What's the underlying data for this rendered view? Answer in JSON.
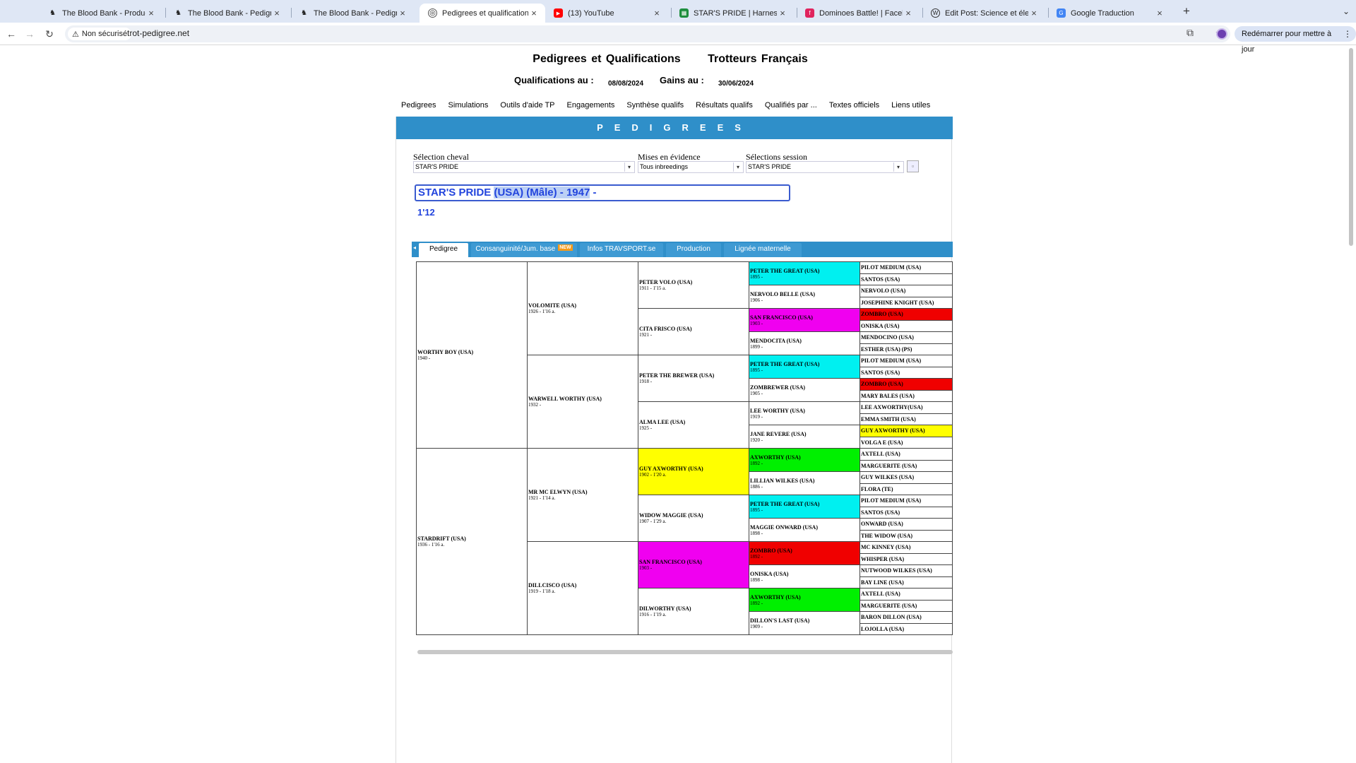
{
  "browser": {
    "tabs": [
      {
        "label": "The Blood Bank - Production",
        "icon": "horse-favicon",
        "active": false
      },
      {
        "label": "The Blood Bank - Pedigree",
        "icon": "horse-favicon",
        "active": false
      },
      {
        "label": "The Blood Bank - Pedigree",
        "icon": "horse-favicon",
        "active": false
      },
      {
        "label": "Pedigrees et qualifications Tr",
        "icon": "globe-icon",
        "active": true
      },
      {
        "label": "(13) YouTube",
        "icon": "youtube-icon",
        "active": false
      },
      {
        "label": "STAR'S PRIDE | Harness Musi",
        "icon": "sheets-icon",
        "active": false
      },
      {
        "label": "Dominoes Battle! | Facebook",
        "icon": "facebook-icon",
        "active": false
      },
      {
        "label": "Edit Post: Science et élevage",
        "icon": "wordpress-icon",
        "active": false
      },
      {
        "label": "Google Traduction",
        "icon": "translate-icon",
        "active": false
      }
    ],
    "security_label": "Non sécurisé",
    "url": "trot-pedigree.net",
    "restart_label": "Redémarrer pour mettre à jour"
  },
  "header": {
    "title_left": "Pedigrees et Qualifications",
    "title_right": "Trotteurs Français",
    "qual_label": "Qualifications au :",
    "qual_date": "08/08/2024",
    "gains_label": "Gains au :",
    "gains_date": "30/06/2024"
  },
  "menu": [
    "Pedigrees",
    "Simulations",
    "Outils d'aide TP",
    "Engagements",
    "Synthèse qualifs",
    "Résultats qualifs",
    "Qualifiés par ...",
    "Textes officiels",
    "Liens utiles"
  ],
  "banner": "PEDIGREES",
  "selectors": {
    "horse_label": "Sélection cheval",
    "horse_value": "STAR'S PRIDE",
    "highlight_label": "Mises en évidence",
    "highlight_value": "Tous inbreedings",
    "session_label": "Sélections session",
    "session_value": "STAR'S PRIDE"
  },
  "horse": {
    "name": "STAR'S PRIDE",
    "country": "(USA)",
    "sex": "(Mâle)",
    "year": "1947",
    "header_line_a": "STAR'S PRIDE ",
    "header_line_b": "(USA) (Mâle)  - 1947",
    "header_line_c": " -",
    "record": "1'12"
  },
  "pedigree_tabs": [
    {
      "label": "Pedigree",
      "active": true,
      "new": false
    },
    {
      "label": "Consanguinité/Jum. base",
      "active": false,
      "new": true,
      "badge": "NEW"
    },
    {
      "label": "Infos TRAVSPORT.se",
      "active": false,
      "new": false
    },
    {
      "label": "Production",
      "active": false,
      "new": false
    },
    {
      "label": "Lignée maternelle",
      "active": false,
      "new": false
    }
  ],
  "pedigree": {
    "gen1": [
      {
        "name": "WORTHY BOY (USA)",
        "info": "1940 -"
      },
      {
        "name": "STARDRIFT (USA)",
        "info": "1936 - 1'16 a."
      }
    ],
    "gen2": [
      {
        "name": "VOLOMITE (USA)",
        "info": "1926 - 1'16 a."
      },
      {
        "name": "WARWELL WORTHY (USA)",
        "info": "1932 -"
      },
      {
        "name": "MR MC ELWYN (USA)",
        "info": "1921 - 1'14 a."
      },
      {
        "name": "DILLCISCO (USA)",
        "info": "1919 - 1'18 a."
      }
    ],
    "gen3": [
      {
        "name": "PETER VOLO (USA)",
        "info": "1911 - 1'15 a.",
        "color": ""
      },
      {
        "name": "CITA FRISCO (USA)",
        "info": "1921 -",
        "color": ""
      },
      {
        "name": "PETER THE BREWER (USA)",
        "info": "1918 -",
        "color": ""
      },
      {
        "name": "ALMA LEE (USA)",
        "info": "1925 -",
        "color": ""
      },
      {
        "name": "GUY AXWORTHY (USA)",
        "info": "1902 - 1'20 a.",
        "color": "yellow"
      },
      {
        "name": "WIDOW MAGGIE (USA)",
        "info": "1907 - 1'29 a.",
        "color": ""
      },
      {
        "name": "SAN FRANCISCO (USA)",
        "info": "1903 -",
        "color": "magenta"
      },
      {
        "name": "DILWORTHY (USA)",
        "info": "1916 - 1'19 a.",
        "color": ""
      }
    ],
    "gen4": [
      {
        "name": "PETER THE GREAT (USA)",
        "info": "1895 -",
        "color": "cyan"
      },
      {
        "name": "NERVOLO BELLE (USA)",
        "info": "1906 -",
        "color": ""
      },
      {
        "name": "SAN FRANCISCO (USA)",
        "info": "1903 -",
        "color": "magenta"
      },
      {
        "name": "MENDOCITA (USA)",
        "info": "1899 -",
        "color": ""
      },
      {
        "name": "PETER THE GREAT (USA)",
        "info": "1895 -",
        "color": "cyan"
      },
      {
        "name": "ZOMBREWER (USA)",
        "info": "1905 -",
        "color": ""
      },
      {
        "name": "LEE WORTHY (USA)",
        "info": "1919 -",
        "color": ""
      },
      {
        "name": "JANE REVERE (USA)",
        "info": "1920 -",
        "color": ""
      },
      {
        "name": "AXWORTHY (USA)",
        "info": "1892 -",
        "color": "green"
      },
      {
        "name": "LILLIAN WILKES (USA)",
        "info": "1886 -",
        "color": ""
      },
      {
        "name": "PETER THE GREAT (USA)",
        "info": "1895 -",
        "color": "cyan"
      },
      {
        "name": "MAGGIE ONWARD (USA)",
        "info": "1898 -",
        "color": ""
      },
      {
        "name": "ZOMBRO (USA)",
        "info": "1892 -",
        "color": "red"
      },
      {
        "name": "ONISKA (USA)",
        "info": "1898 -",
        "color": ""
      },
      {
        "name": "AXWORTHY (USA)",
        "info": "1892 -",
        "color": "green"
      },
      {
        "name": "DILLON'S LAST (USA)",
        "info": "1909 -",
        "color": ""
      }
    ],
    "gen5": [
      {
        "name": "PILOT MEDIUM (USA)",
        "color": ""
      },
      {
        "name": "SANTOS (USA)",
        "color": ""
      },
      {
        "name": "NERVOLO (USA)",
        "color": ""
      },
      {
        "name": "JOSEPHINE KNIGHT (USA)",
        "color": ""
      },
      {
        "name": "ZOMBRO (USA)",
        "color": "red"
      },
      {
        "name": "ONISKA (USA)",
        "color": ""
      },
      {
        "name": "MENDOCINO (USA)",
        "color": ""
      },
      {
        "name": "ESTHER (USA) (PS)",
        "color": ""
      },
      {
        "name": "PILOT MEDIUM (USA)",
        "color": ""
      },
      {
        "name": "SANTOS (USA)",
        "color": ""
      },
      {
        "name": "ZOMBRO (USA)",
        "color": "red"
      },
      {
        "name": "MARY BALES (USA)",
        "color": ""
      },
      {
        "name": "LEE AXWORTHY(USA)",
        "color": ""
      },
      {
        "name": "EMMA SMITH (USA)",
        "color": ""
      },
      {
        "name": "GUY AXWORTHY (USA)",
        "color": "yellow"
      },
      {
        "name": "VOLGA E (USA)",
        "color": ""
      },
      {
        "name": "AXTELL (USA)",
        "color": ""
      },
      {
        "name": "MARGUERITE (USA)",
        "color": ""
      },
      {
        "name": "GUY WILKES (USA)",
        "color": ""
      },
      {
        "name": "FLORA (TE)",
        "color": ""
      },
      {
        "name": "PILOT MEDIUM (USA)",
        "color": ""
      },
      {
        "name": "SANTOS (USA)",
        "color": ""
      },
      {
        "name": "ONWARD (USA)",
        "color": ""
      },
      {
        "name": "THE WIDOW (USA)",
        "color": ""
      },
      {
        "name": "MC KINNEY (USA)",
        "color": ""
      },
      {
        "name": "WHISPER (USA)",
        "color": ""
      },
      {
        "name": "NUTWOOD WILKES (USA)",
        "color": ""
      },
      {
        "name": "BAY LINE (USA)",
        "color": ""
      },
      {
        "name": "AXTELL (USA)",
        "color": ""
      },
      {
        "name": "MARGUERITE (USA)",
        "color": ""
      },
      {
        "name": "BARON DILLON (USA)",
        "color": ""
      },
      {
        "name": "LOJOLLA (USA)",
        "color": ""
      }
    ]
  },
  "colors": {
    "banner": "#2f8fc9",
    "cyan": "#00f0f0",
    "magenta": "#f000f0",
    "red": "#f00000",
    "yellow": "#ffff00",
    "green": "#00f000",
    "horse_text": "#2244dd"
  }
}
